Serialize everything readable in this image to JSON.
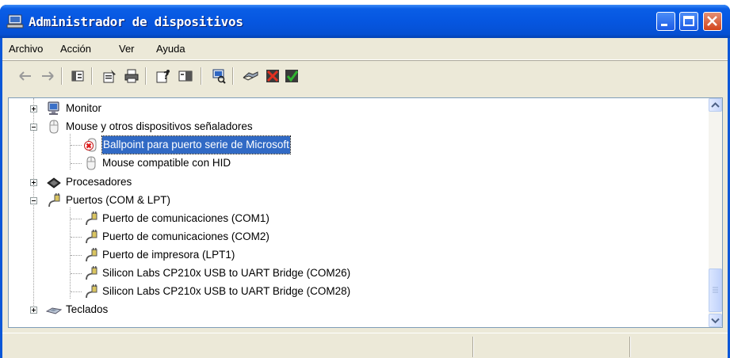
{
  "window": {
    "title": "Administrador de dispositivos"
  },
  "menu": [
    "Archivo",
    "Acción",
    "Ver",
    "Ayuda"
  ],
  "toolbar_icons": [
    "back-arrow-icon",
    "forward-arrow-icon",
    "show-hide-console-tree-icon",
    "properties-icon",
    "print-icon",
    "help-icon",
    "details-pane-icon",
    "scan-hardware-icon",
    "update-driver-icon",
    "uninstall-icon",
    "disable-device-icon"
  ],
  "tree": {
    "monitor": "Monitor",
    "mouse_group": "Mouse y otros dispositivos señaladores",
    "ballpoint": "Ballpoint para puerto serie de Microsoft",
    "hid_mouse": "Mouse compatible con HID",
    "processors": "Procesadores",
    "ports": "Puertos (COM & LPT)",
    "com1": "Puerto de comunicaciones (COM1)",
    "com2": "Puerto de comunicaciones (COM2)",
    "lpt1": "Puerto de impresora (LPT1)",
    "com26": "Silicon Labs CP210x USB to UART Bridge (COM26)",
    "com28": "Silicon Labs CP210x USB to UART Bridge (COM28)",
    "keyboards": "Teclados"
  },
  "colors": {
    "title_blue": "#0656e0",
    "selection": "#316ac5",
    "close_red": "#d2441c"
  }
}
